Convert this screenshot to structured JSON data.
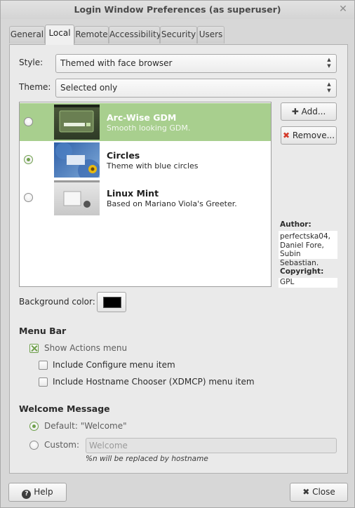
{
  "window": {
    "title": "Login Window Preferences (as superuser)",
    "close_glyph": "✕"
  },
  "tabs": [
    {
      "label": "General"
    },
    {
      "label": "Local"
    },
    {
      "label": "Remote"
    },
    {
      "label": "Accessibility"
    },
    {
      "label": "Security"
    },
    {
      "label": "Users"
    }
  ],
  "style": {
    "label": "Style:",
    "value": "Themed with face browser"
  },
  "theme": {
    "label": "Theme:",
    "value": "Selected only"
  },
  "themes": [
    {
      "name": "Arc-Wise GDM",
      "desc": "Smooth looking GDM.",
      "selected_row": true,
      "radio_on": false
    },
    {
      "name": "Circles",
      "desc": "Theme with blue circles",
      "selected_row": false,
      "radio_on": true
    },
    {
      "name": "Linux Mint",
      "desc": "Based on Mariano Viola's Greeter.",
      "selected_row": false,
      "radio_on": false
    }
  ],
  "buttons": {
    "add": "Add...",
    "remove": "Remove...",
    "help": "Help",
    "close": "Close"
  },
  "author": {
    "label": "Author:",
    "lines": [
      "perfectska04,",
      "Daniel Fore,",
      "Subin Sebastian."
    ]
  },
  "copyright": {
    "label": "Copyright:",
    "value": "GPL"
  },
  "background": {
    "label": "Background color:",
    "color": "#000000"
  },
  "menu_bar": {
    "title": "Menu Bar",
    "show_actions": {
      "label": "Show Actions menu",
      "checked": true
    },
    "include_configure": {
      "label": "Include Configure menu item",
      "checked": false
    },
    "include_hostname": {
      "label": "Include Hostname Chooser (XDMCP) menu item",
      "checked": false
    }
  },
  "welcome": {
    "title": "Welcome Message",
    "default_label": "Default: \"Welcome\"",
    "custom_label": "Custom:",
    "custom_placeholder": "Welcome",
    "hint": "%n will be replaced by hostname",
    "selected": "default"
  },
  "colors": {
    "accent": "#6fa04c",
    "selection": "#a8cf8e",
    "remove_icon": "#d43a2a"
  },
  "icons": {
    "add": "plus-icon",
    "remove": "x-icon",
    "help": "help-icon",
    "close": "x-icon",
    "combo": "updown-arrows-icon"
  }
}
